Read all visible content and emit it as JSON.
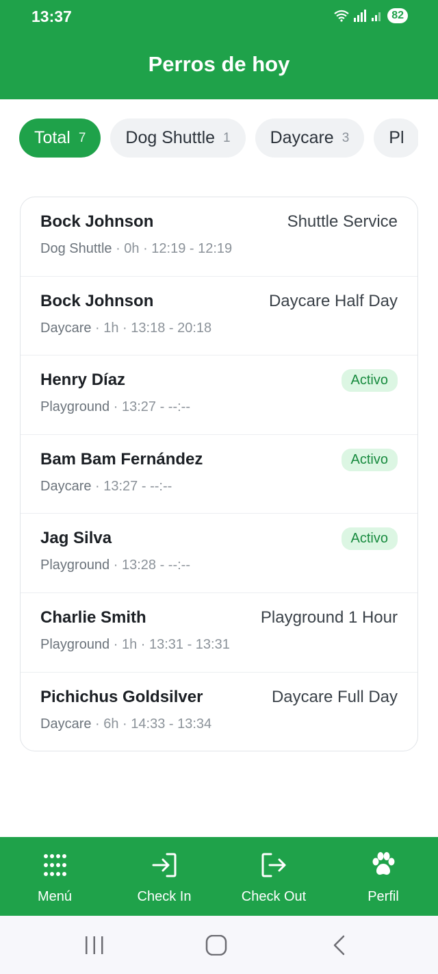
{
  "status_bar": {
    "time": "13:37",
    "battery": "82"
  },
  "header": {
    "title": "Perros de hoy"
  },
  "tabs": [
    {
      "label": "Total",
      "count": "7"
    },
    {
      "label": "Dog Shuttle",
      "count": "1"
    },
    {
      "label": "Daycare",
      "count": "3"
    },
    {
      "label": "Pl",
      "count": ""
    }
  ],
  "entries": [
    {
      "name": "Bock Johnson",
      "service": "Dog Shuttle",
      "details": " · 0h · 12:19 - 12:19",
      "right": "Shuttle Service"
    },
    {
      "name": "Bock Johnson",
      "service": "Daycare",
      "details": " · 1h · 13:18 - 20:18",
      "right": "Daycare Half Day"
    },
    {
      "name": "Henry Díaz",
      "service": "Playground",
      "details": " · 13:27 - --:--",
      "badge": "Activo"
    },
    {
      "name": "Bam Bam Fernández",
      "service": "Daycare",
      "details": " · 13:27 - --:--",
      "badge": "Activo"
    },
    {
      "name": "Jag Silva",
      "service": "Playground",
      "details": " · 13:28 - --:--",
      "badge": "Activo"
    },
    {
      "name": "Charlie Smith",
      "service": "Playground",
      "details": " · 1h · 13:31 - 13:31",
      "right": "Playground 1 Hour"
    },
    {
      "name": "Pichichus Goldsilver",
      "service": "Daycare",
      "details": " · 6h · 14:33 - 13:34",
      "right": "Daycare Full Day"
    }
  ],
  "bottom_nav": [
    {
      "label": "Menú",
      "icon": "grid-dots-icon"
    },
    {
      "label": "Check In",
      "icon": "check-in-icon"
    },
    {
      "label": "Check Out",
      "icon": "check-out-icon"
    },
    {
      "label": "Perfil",
      "icon": "paw-icon"
    }
  ],
  "colors": {
    "brand": "#1fa24a",
    "badge_bg": "#dcf6e3",
    "badge_text": "#178a3e"
  }
}
